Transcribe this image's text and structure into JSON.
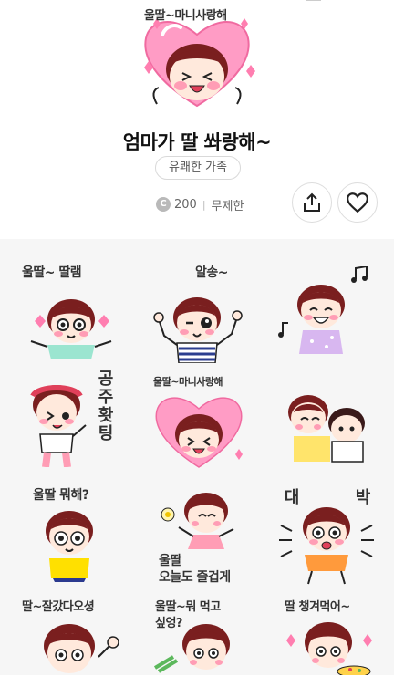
{
  "product": {
    "title": "엄마가 딸 쏴랑해~",
    "category_tag": "유쾌한 가족",
    "coin_symbol": "C",
    "price": "200",
    "separator": "|",
    "license": "무제한",
    "main_caption": "울딸~마니사랑해"
  },
  "actions": {
    "share_icon": "share-icon",
    "like_icon": "heart-outline-icon"
  },
  "stickers": [
    {
      "caption": "울딸~ 딸램"
    },
    {
      "caption": "알송~"
    },
    {
      "caption": ""
    },
    {
      "caption": "공주홧팅"
    },
    {
      "caption": "울딸~마니사랑해"
    },
    {
      "caption": ""
    },
    {
      "caption": "울딸 뭐해?"
    },
    {
      "caption_line1": "울딸",
      "caption_line2": "오늘도 즐겁게"
    },
    {
      "caption_left": "대",
      "caption_right": "박"
    },
    {
      "caption": "딸~잘갔다오셩"
    },
    {
      "caption_line1": "울딸~뭐 먹고",
      "caption_line2": "싶엉?"
    },
    {
      "caption": "딸 챙겨먹어~"
    }
  ],
  "colors": {
    "hair": "#7a1f1f",
    "skin": "#ffe9dc",
    "cheek": "#ff9db5",
    "heart": "#ff7eb0",
    "heart_light": "#ffc4dc"
  }
}
